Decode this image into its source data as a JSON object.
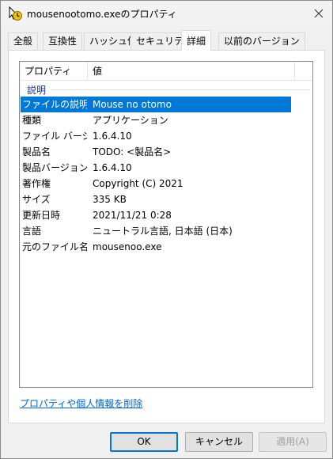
{
  "window": {
    "title": "mousenootomo.exeのプロパティ",
    "icon": "app-clock-icon",
    "close": "close-icon"
  },
  "tabs": [
    {
      "label": "全般",
      "active": false
    },
    {
      "label": "互換性",
      "active": false
    },
    {
      "label": "ハッシュ値",
      "active": false
    },
    {
      "label": "セキュリティ",
      "active": false
    },
    {
      "label": "詳細",
      "active": true
    },
    {
      "label": "以前のバージョン",
      "active": false
    }
  ],
  "details": {
    "columns": [
      "プロパティ",
      "値"
    ],
    "group": "説明",
    "rows": [
      {
        "property": "ファイルの説明",
        "value": "Mouse no otomo",
        "selected": true
      },
      {
        "property": "種類",
        "value": "アプリケーション",
        "selected": false
      },
      {
        "property": "ファイル バージョン",
        "value": "1.6.4.10",
        "selected": false
      },
      {
        "property": "製品名",
        "value": "TODO: <製品名>",
        "selected": false
      },
      {
        "property": "製品バージョン",
        "value": "1.6.4.10",
        "selected": false
      },
      {
        "property": "著作権",
        "value": "Copyright (C) 2021",
        "selected": false
      },
      {
        "property": "サイズ",
        "value": "335 KB",
        "selected": false
      },
      {
        "property": "更新日時",
        "value": "2021/11/21 0:28",
        "selected": false
      },
      {
        "property": "言語",
        "value": "ニュートラル言語, 日本語 (日本)",
        "selected": false
      },
      {
        "property": "元のファイル名",
        "value": "mousenoo.exe",
        "selected": false
      }
    ]
  },
  "remove_link": "プロパティや個人情報を削除",
  "buttons": {
    "ok": "OK",
    "cancel": "キャンセル",
    "apply": "適用(A)"
  },
  "colors": {
    "selection": "#0078d7",
    "link": "#0066cc",
    "group_label": "#1e3287"
  }
}
